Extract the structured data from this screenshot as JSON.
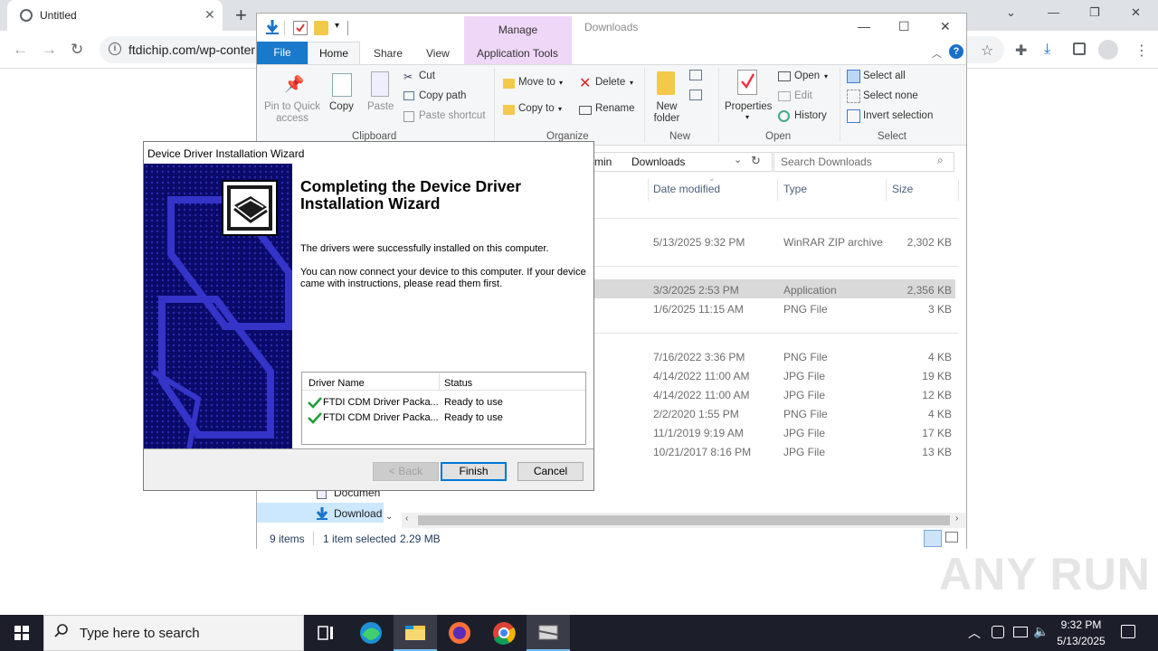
{
  "browser": {
    "tab_title": "Untitled",
    "url": "ftdichip.com/wp-conter"
  },
  "explorer": {
    "title": "Downloads",
    "context_tab": "Manage",
    "ribbon_tabs": [
      "File",
      "Home",
      "Share",
      "View",
      "Application Tools"
    ],
    "clipboard": {
      "pin": "Pin to Quick access",
      "copy": "Copy",
      "paste": "Paste",
      "cut": "Cut",
      "copy_path": "Copy path",
      "paste_shortcut": "Paste shortcut",
      "group": "Clipboard"
    },
    "organize": {
      "move_to": "Move to",
      "delete": "Delete",
      "copy_to": "Copy to",
      "rename": "Rename",
      "group": "Organize"
    },
    "new": {
      "new_folder": "New folder",
      "group": "New"
    },
    "open": {
      "properties": "Properties",
      "open": "Open",
      "edit": "Edit",
      "history": "History",
      "group": "Open"
    },
    "select": {
      "select_all": "Select all",
      "select_none": "Select none",
      "invert": "Invert selection",
      "group": "Select"
    },
    "address": {
      "parent": "min",
      "current": "Downloads"
    },
    "search_placeholder": "Search Downloads",
    "columns": [
      "Date modified",
      "Type",
      "Size"
    ],
    "rows": [
      {
        "date": "5/13/2025 9:32 PM",
        "type": "WinRAR ZIP archive",
        "size": "2,302 KB"
      },
      {
        "date": "3/3/2025 2:53 PM",
        "type": "Application",
        "size": "2,356 KB"
      },
      {
        "date": "1/6/2025 11:15 AM",
        "type": "PNG File",
        "size": "3 KB"
      },
      {
        "date": "7/16/2022 3:36 PM",
        "type": "PNG File",
        "size": "4 KB"
      },
      {
        "date": "4/14/2022 11:00 AM",
        "type": "JPG File",
        "size": "19 KB"
      },
      {
        "date": "4/14/2022 11:00 AM",
        "type": "JPG File",
        "size": "12 KB"
      },
      {
        "date": "2/2/2020 1:55 PM",
        "type": "PNG File",
        "size": "4 KB"
      },
      {
        "date": "11/1/2019 9:19 AM",
        "type": "JPG File",
        "size": "17 KB"
      },
      {
        "date": "10/21/2017 8:16 PM",
        "type": "JPG File",
        "size": "13 KB"
      }
    ],
    "nav": {
      "documents": "Documen",
      "downloads": "Download"
    },
    "status": {
      "items": "9 items",
      "selected": "1 item selected",
      "size": "2.29 MB"
    }
  },
  "wizard": {
    "title": "Device Driver Installation Wizard",
    "heading": "Completing the Device Driver Installation Wizard",
    "line1": "The drivers were successfully installed on this computer.",
    "line2": "You can now connect your device to this computer. If your device came with instructions, please read them first.",
    "table_headers": [
      "Driver Name",
      "Status"
    ],
    "drivers": [
      {
        "name": "FTDI CDM Driver Packa...",
        "status": "Ready to use"
      },
      {
        "name": "FTDI CDM Driver Packa...",
        "status": "Ready to use"
      }
    ],
    "back_label": "< Back",
    "finish_label": "Finish",
    "cancel_label": "Cancel"
  },
  "watermark": "ANY RUN",
  "taskbar": {
    "search_placeholder": "Type here to search",
    "time": "9:32 PM",
    "date": "5/13/2025"
  }
}
